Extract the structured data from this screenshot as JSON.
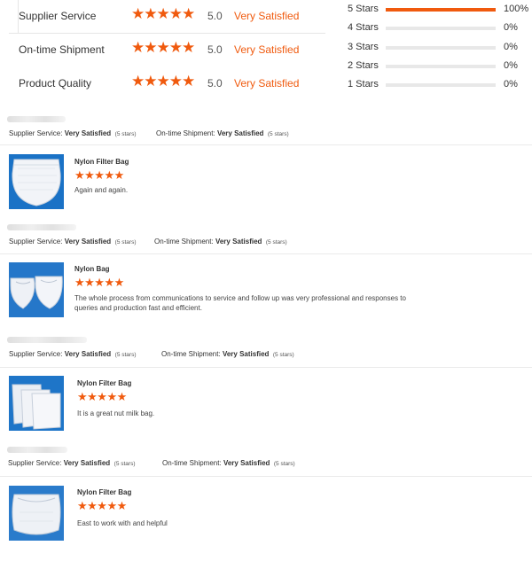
{
  "summary": {
    "metrics": [
      {
        "label": "Supplier Service",
        "stars": "★★★★★",
        "score": "5.0",
        "text": "Very Satisfied"
      },
      {
        "label": "On-time Shipment",
        "stars": "★★★★★",
        "score": "5.0",
        "text": "Very Satisfied"
      },
      {
        "label": "Product Quality",
        "stars": "★★★★★",
        "score": "5.0",
        "text": "Very Satisfied"
      }
    ],
    "distribution": [
      {
        "label": "5  Stars",
        "pct": "100%",
        "fraction": 1.0
      },
      {
        "label": "4  Stars",
        "pct": "0%",
        "fraction": 0
      },
      {
        "label": "3  Stars",
        "pct": "0%",
        "fraction": 0
      },
      {
        "label": "2  Stars",
        "pct": "0%",
        "fraction": 0
      },
      {
        "label": "1  Stars",
        "pct": "0%",
        "fraction": 0
      }
    ]
  },
  "reviews": [
    {
      "supplier_label": "Supplier Service:",
      "supplier_value": "Very Satisfied",
      "supplier_count": "(5 stars)",
      "shipment_label": "On-time Shipment:",
      "shipment_value": "Very Satisfied",
      "shipment_count": "(5 stars)",
      "product": "Nylon  Filter Bag",
      "stars": "★★★★★",
      "text": "Again and again."
    },
    {
      "supplier_label": "Supplier Service:",
      "supplier_value": "Very Satisfied",
      "supplier_count": "(5 stars)",
      "shipment_label": "On-time Shipment:",
      "shipment_value": "Very Satisfied",
      "shipment_count": "(5 stars)",
      "product": "Nylon Bag",
      "stars": "★★★★★",
      "text": "The whole process from communications to service and follow up was very professional and responses to queries and production fast and efficient."
    },
    {
      "supplier_label": "Supplier Service:",
      "supplier_value": "Very Satisfied",
      "supplier_count": "(5 stars)",
      "shipment_label": "On-time Shipment:",
      "shipment_value": "Very Satisfied",
      "shipment_count": "(5 stars)",
      "product": "Nylon  Filter Bag",
      "stars": "★★★★★",
      "text": "It is a great nut milk bag."
    },
    {
      "supplier_label": "Supplier Service:",
      "supplier_value": "Very Satisfied",
      "supplier_count": "(5 stars)",
      "shipment_label": "On-time Shipment:",
      "shipment_value": "Very Satisfied",
      "shipment_count": "(5 stars)",
      "product": "Nylon Filter Bag",
      "stars": "★★★★★",
      "text": "East to work with and helpful"
    }
  ],
  "colors": {
    "accent": "#f05a0e",
    "thumb_bg": "#1a72c6"
  },
  "icons": {
    "rating": "star-icon",
    "product_image": "filter-bag-image"
  }
}
